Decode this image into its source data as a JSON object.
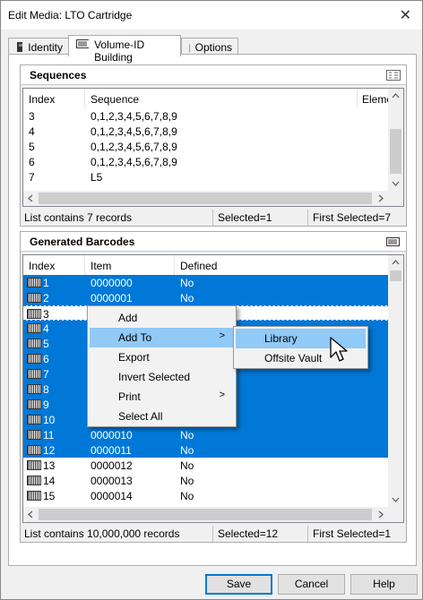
{
  "window": {
    "title": "Edit Media: LTO Cartridge",
    "close_glyph": "✕"
  },
  "tabs": [
    {
      "label": "Identity",
      "icon": "tape-icon"
    },
    {
      "label": "Volume-ID Building",
      "icon": "barcode-icon"
    },
    {
      "label": "Options",
      "icon": "options-icon"
    }
  ],
  "sequences": {
    "title": "Sequences",
    "columns": [
      "Index",
      "Sequence",
      "Elemen"
    ],
    "rows": [
      {
        "index": "3",
        "sequence": "0,1,2,3,4,5,6,7,8,9"
      },
      {
        "index": "4",
        "sequence": "0,1,2,3,4,5,6,7,8,9"
      },
      {
        "index": "5",
        "sequence": "0,1,2,3,4,5,6,7,8,9"
      },
      {
        "index": "6",
        "sequence": "0,1,2,3,4,5,6,7,8,9"
      },
      {
        "index": "7",
        "sequence": "L5"
      }
    ],
    "status": {
      "count": "List contains 7 records",
      "selected": "Selected=1",
      "first": "First Selected=7"
    }
  },
  "barcodes": {
    "title": "Generated Barcodes",
    "columns": [
      "Index",
      "Item",
      "Defined"
    ],
    "rows": [
      {
        "index": "1",
        "item": "0000000",
        "defined": "No",
        "selected": true
      },
      {
        "index": "2",
        "item": "0000001",
        "defined": "No",
        "selected": true
      },
      {
        "index": "3",
        "item": "",
        "defined": "",
        "selected": false
      },
      {
        "index": "4",
        "item": "",
        "defined": "",
        "selected": true
      },
      {
        "index": "5",
        "item": "",
        "defined": "",
        "selected": true
      },
      {
        "index": "6",
        "item": "",
        "defined": "",
        "selected": true
      },
      {
        "index": "7",
        "item": "",
        "defined": "",
        "selected": true
      },
      {
        "index": "8",
        "item": "",
        "defined": "",
        "selected": true
      },
      {
        "index": "9",
        "item": "",
        "defined": "",
        "selected": true
      },
      {
        "index": "10",
        "item": "",
        "defined": "",
        "selected": true
      },
      {
        "index": "11",
        "item": "0000010",
        "defined": "No",
        "selected": true
      },
      {
        "index": "12",
        "item": "0000011",
        "defined": "No",
        "selected": true
      },
      {
        "index": "13",
        "item": "0000012",
        "defined": "No",
        "selected": false
      },
      {
        "index": "14",
        "item": "0000013",
        "defined": "No",
        "selected": false
      },
      {
        "index": "15",
        "item": "0000014",
        "defined": "No",
        "selected": false
      }
    ],
    "status": {
      "count": "List contains 10,000,000 records",
      "selected": "Selected=12",
      "first": "First Selected=1"
    }
  },
  "context_menu": {
    "items": [
      "Add",
      "Add To",
      "Export",
      "Invert Selected",
      "Print",
      "Select All"
    ],
    "submenu_arrow": ">",
    "highlighted": "Add To"
  },
  "submenu": {
    "items": [
      "Library",
      "Offsite Vault"
    ],
    "highlighted": "Library"
  },
  "buttons": {
    "save": "Save",
    "cancel": "Cancel",
    "help": "Help"
  },
  "colors": {
    "selection": "#0078d7",
    "menu_highlight": "#91c9f7"
  }
}
